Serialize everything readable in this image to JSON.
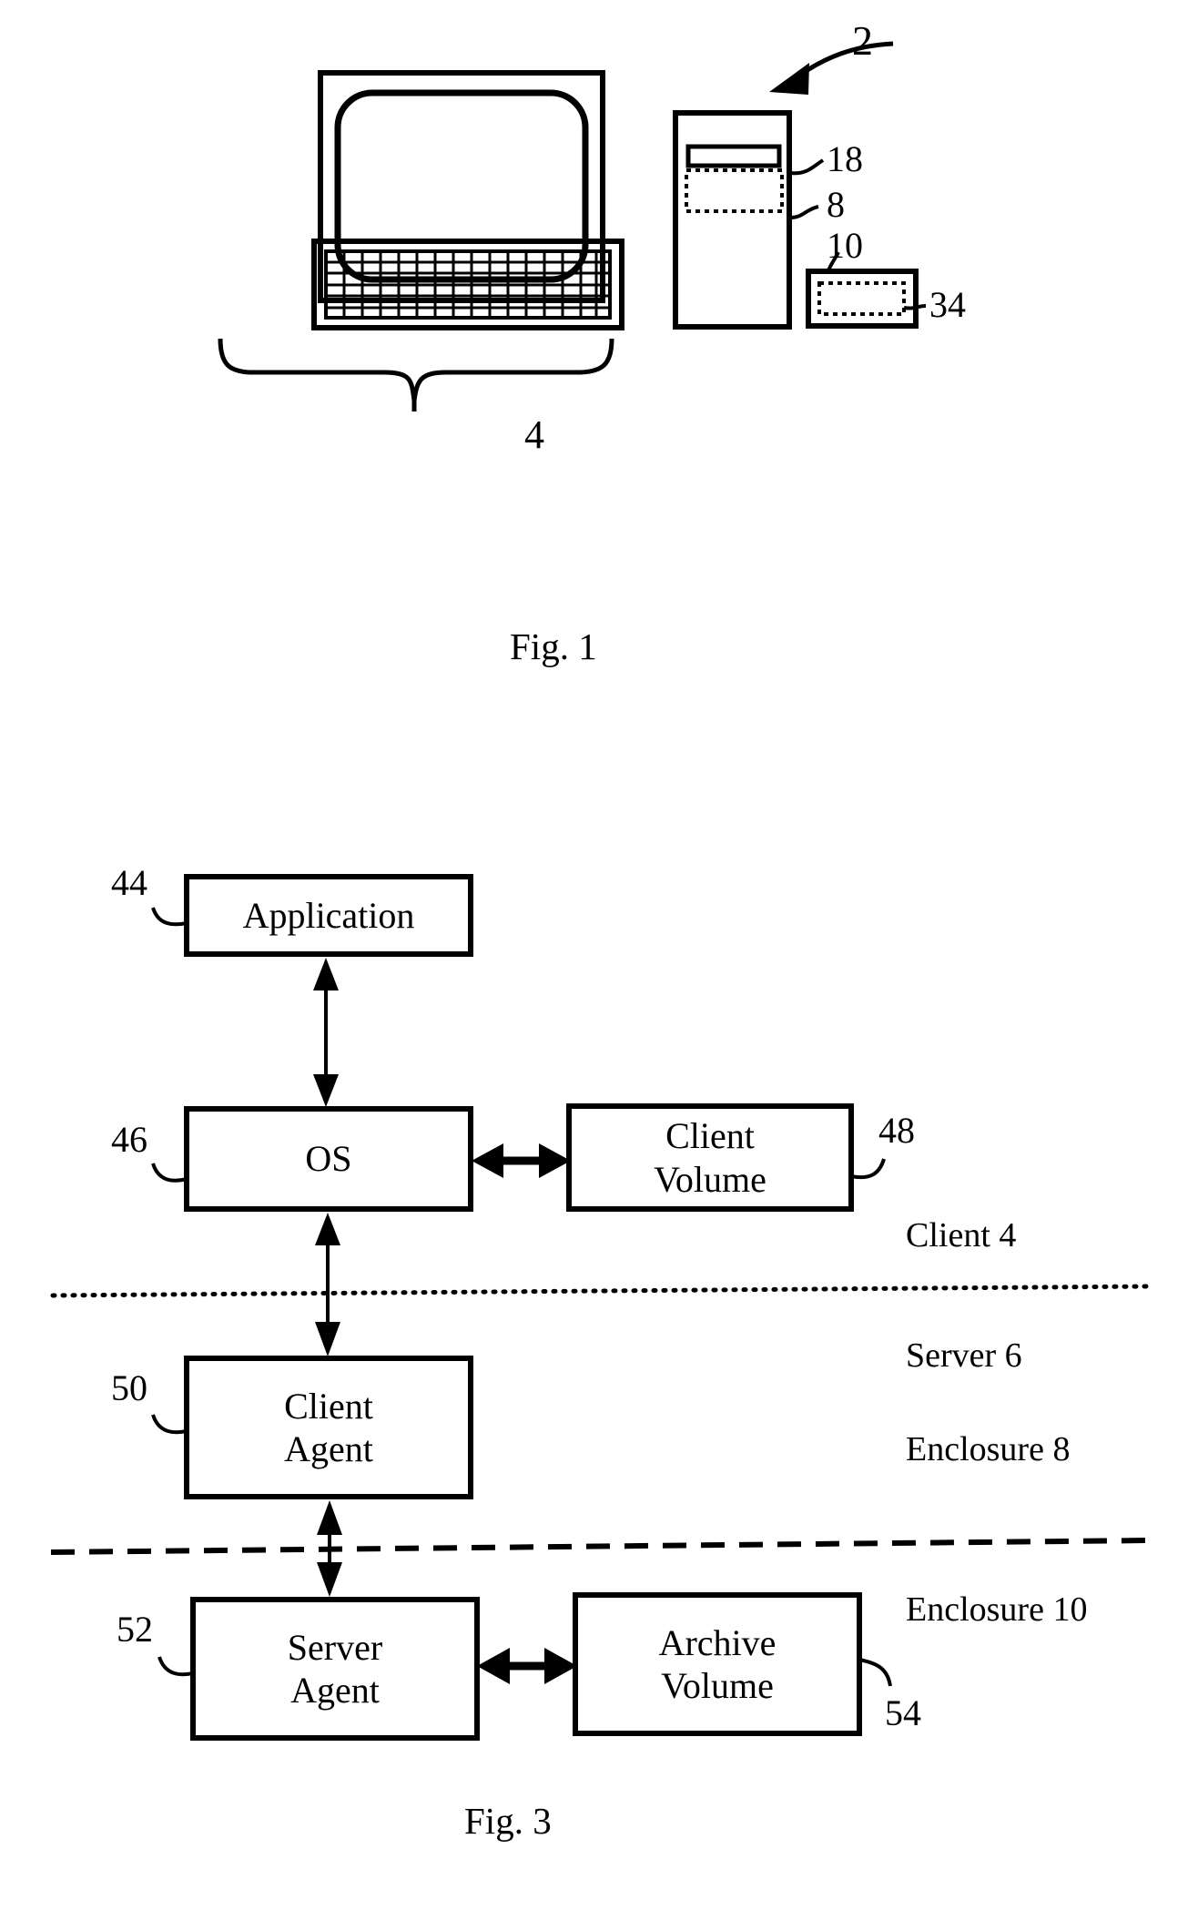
{
  "document": {
    "type": "patent-drawing-sheet",
    "ink_color": "#000000",
    "background_color": "#ffffff"
  },
  "figures": [
    {
      "id": "fig1",
      "caption": "Fig. 1",
      "title_ref": "2",
      "description": "Computer system: monitor, keyboard, tower enclosure and separate small enclosure",
      "reference_numerals": [
        {
          "label": "2",
          "target": "system-arrow"
        },
        {
          "label": "18",
          "target": "tower-internal-component"
        },
        {
          "label": "8",
          "target": "tower-enclosure"
        },
        {
          "label": "10",
          "target": "small-enclosure"
        },
        {
          "label": "34",
          "target": "small-enclosure-internal-component"
        },
        {
          "label": "4",
          "target": "client-brace"
        }
      ]
    },
    {
      "id": "fig3",
      "caption": "Fig. 3",
      "description": "Block diagram of client/server archive architecture",
      "blocks": [
        {
          "ref": "44",
          "lines": [
            "Application"
          ],
          "name": "application-block"
        },
        {
          "ref": "46",
          "lines": [
            "OS"
          ],
          "name": "os-block"
        },
        {
          "ref": "48",
          "lines": [
            "Client",
            "Volume"
          ],
          "name": "client-volume-block"
        },
        {
          "ref": "50",
          "lines": [
            "Client",
            "Agent"
          ],
          "name": "client-agent-block"
        },
        {
          "ref": "52",
          "lines": [
            "Server",
            "Agent"
          ],
          "name": "server-agent-block"
        },
        {
          "ref": "54",
          "lines": [
            "Archive",
            "Volume"
          ],
          "name": "archive-volume-block"
        }
      ],
      "zone_labels": [
        {
          "text": "Client 4",
          "name": "zone-client"
        },
        {
          "text": "Server 6",
          "name": "zone-server"
        },
        {
          "text": "Enclosure 8",
          "name": "zone-enclosure-8"
        },
        {
          "text": "Enclosure 10",
          "name": "zone-enclosure-10"
        }
      ],
      "dividers": [
        {
          "style": "dotted",
          "name": "client-server-divider"
        },
        {
          "style": "dashed",
          "name": "enclosure-divider"
        }
      ],
      "connectors": [
        {
          "from": "application-block",
          "to": "os-block",
          "kind": "double-arrow-vertical"
        },
        {
          "from": "os-block",
          "to": "client-volume-block",
          "kind": "double-arrow-horizontal"
        },
        {
          "from": "os-block",
          "to": "client-agent-block",
          "kind": "double-arrow-vertical"
        },
        {
          "from": "client-agent-block",
          "to": "server-agent-block",
          "kind": "double-arrow-vertical"
        },
        {
          "from": "server-agent-block",
          "to": "archive-volume-block",
          "kind": "double-arrow-horizontal"
        }
      ]
    }
  ],
  "fig1": {
    "ref_2": "2",
    "ref_18": "18",
    "ref_8": "8",
    "ref_10": "10",
    "ref_34": "34",
    "ref_4": "4",
    "caption": "Fig. 1"
  },
  "fig3": {
    "ref_44": "44",
    "ref_46": "46",
    "ref_48": "48",
    "ref_50": "50",
    "ref_52": "52",
    "ref_54": "54",
    "application": "Application",
    "os": "OS",
    "client_volume_line1": "Client",
    "client_volume_line2": "Volume",
    "client_agent_line1": "Client",
    "client_agent_line2": "Agent",
    "server_agent_line1": "Server",
    "server_agent_line2": "Agent",
    "archive_volume_line1": "Archive",
    "archive_volume_line2": "Volume",
    "zone_client": "Client 4",
    "zone_server": "Server 6",
    "zone_enclosure8": "Enclosure 8",
    "zone_enclosure10": "Enclosure 10",
    "caption": "Fig. 3"
  }
}
